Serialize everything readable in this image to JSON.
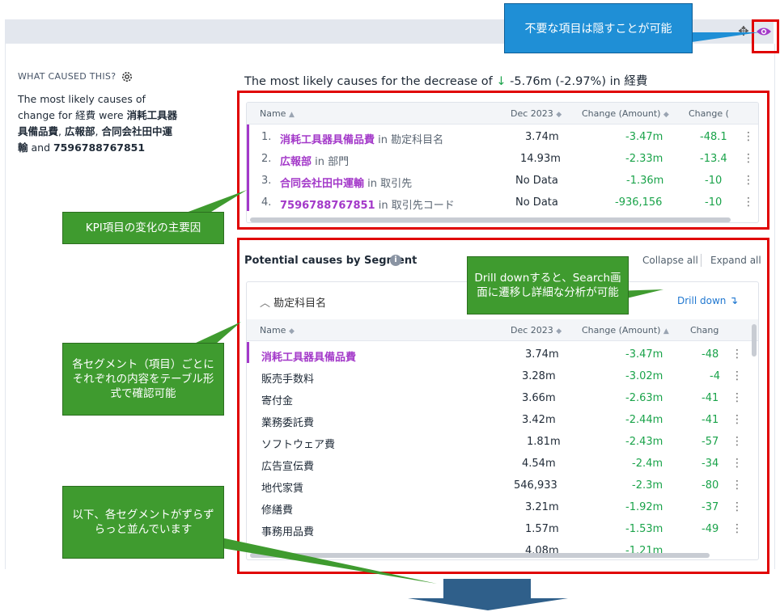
{
  "toolbar": {
    "move_icon": "move-icon",
    "eye_icon": "eye-icon"
  },
  "left": {
    "what_caused_label": "WHAT CAUSED THIS?",
    "summary_parts": {
      "p1": "The most likely causes of change for 経費 were ",
      "c1": "消耗工具器具備品費",
      "sep1": ", ",
      "c2": "広報部",
      "sep2": ", ",
      "c3": "合同会社田中運輸",
      "and": " and ",
      "c4": "7596788767851"
    }
  },
  "headline": {
    "prefix": "The most likely causes for the decrease of ",
    "arrow": "↓",
    "value": " -5.76m (-2.97%) in 経費"
  },
  "top_table": {
    "columns": [
      "Name",
      "Dec 2023",
      "Change (Amount)",
      "Change ("
    ],
    "rows": [
      {
        "idx": "1.",
        "name": "消耗工具器具備品費",
        "in": "in 勘定科目名",
        "dec": "3.74m",
        "amount": "-3.47m",
        "pct": "-48.1"
      },
      {
        "idx": "2.",
        "name": "広報部",
        "in": "in 部門",
        "dec": "14.93m",
        "amount": "-2.33m",
        "pct": "-13.4"
      },
      {
        "idx": "3.",
        "name": "合同会社田中運輸",
        "in": "in 取引先",
        "dec": "No Data",
        "amount": "-1.36m",
        "pct": "-10"
      },
      {
        "idx": "4.",
        "name": "7596788767851",
        "in": "in 取引先コード",
        "dec": "No Data",
        "amount": "-936,156",
        "pct": "-10"
      }
    ]
  },
  "segments": {
    "title": "Potential causes by Segment",
    "collapse_all": "Collapse all",
    "expand_all": "Expand all",
    "group": {
      "title": "勘定科目名",
      "drill_down": "Drill down",
      "columns": [
        "Name",
        "Dec 2023",
        "Change (Amount)",
        "Chang"
      ],
      "rows": [
        {
          "name": "消耗工具器具備品費",
          "dec": "3.74m",
          "amount": "-3.47m",
          "pct": "-48"
        },
        {
          "name": "販売手数料",
          "dec": "3.28m",
          "amount": "-3.02m",
          "pct": "-4"
        },
        {
          "name": "寄付金",
          "dec": "3.66m",
          "amount": "-2.63m",
          "pct": "-41"
        },
        {
          "name": "業務委託費",
          "dec": "3.42m",
          "amount": "-2.44m",
          "pct": "-41"
        },
        {
          "name": "ソフトウェア費",
          "dec": "1.81m",
          "amount": "-2.43m",
          "pct": "-57"
        },
        {
          "name": "広告宣伝費",
          "dec": "4.54m",
          "amount": "-2.4m",
          "pct": "-34"
        },
        {
          "name": "地代家賃",
          "dec": "546,933",
          "amount": "-2.3m",
          "pct": "-80"
        },
        {
          "name": "修繕費",
          "dec": "3.21m",
          "amount": "-1.92m",
          "pct": "-37"
        },
        {
          "name": "事務用品費",
          "dec": "1.57m",
          "amount": "-1.53m",
          "pct": "-49"
        },
        {
          "name": "",
          "dec": "4.08m",
          "amount": "-1.21m",
          "pct": ""
        }
      ]
    }
  },
  "annotations": {
    "hide": "不要な項目は隠すことが可能",
    "kpi": "KPI項目の変化の主要因",
    "drill": "Drill downすると、Search画面に遷移し詳細な分析が可能",
    "segment": "各セグメント（項目）ごとにそれぞれの内容をテーブル形式で確認可能",
    "more": "以下、各セグメントがずらずらっと並んでいます"
  },
  "colors": {
    "accent": "#a339c9",
    "positive": "#1aa34a",
    "annotation": "#3f9b2f",
    "highlight": "#e00000"
  }
}
